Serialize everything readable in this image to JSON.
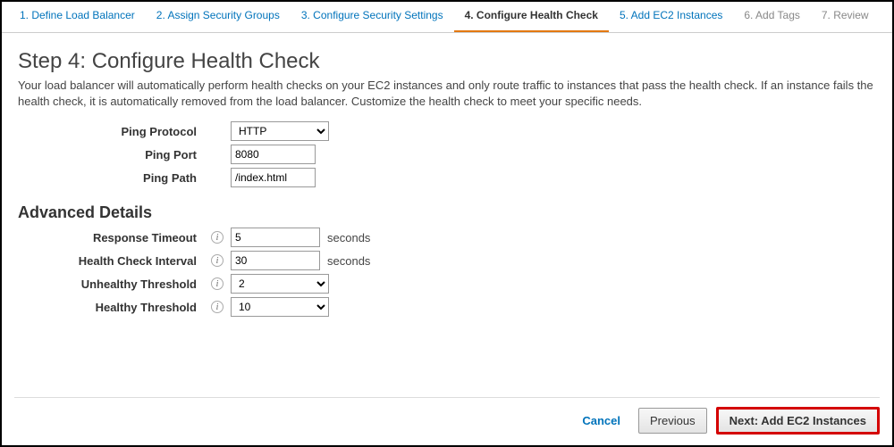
{
  "tabs": {
    "t1": "1. Define Load Balancer",
    "t2": "2. Assign Security Groups",
    "t3": "3. Configure Security Settings",
    "t4": "4. Configure Health Check",
    "t5": "5. Add EC2 Instances",
    "t6": "6. Add Tags",
    "t7": "7. Review"
  },
  "header": {
    "title": "Step 4: Configure Health Check",
    "intro": "Your load balancer will automatically perform health checks on your EC2 instances and only route traffic to instances that pass the health check. If an instance fails the health check, it is automatically removed from the load balancer. Customize the health check to meet your specific needs."
  },
  "form": {
    "ping_protocol": {
      "label": "Ping Protocol",
      "value": "HTTP"
    },
    "ping_port": {
      "label": "Ping Port",
      "value": "8080"
    },
    "ping_path": {
      "label": "Ping Path",
      "value": "/index.html"
    }
  },
  "advanced_title": "Advanced Details",
  "advanced": {
    "response_timeout": {
      "label": "Response Timeout",
      "value": "5",
      "unit": "seconds"
    },
    "interval": {
      "label": "Health Check Interval",
      "value": "30",
      "unit": "seconds"
    },
    "unhealthy_threshold": {
      "label": "Unhealthy Threshold",
      "value": "2"
    },
    "healthy_threshold": {
      "label": "Healthy Threshold",
      "value": "10"
    }
  },
  "footer": {
    "cancel": "Cancel",
    "previous": "Previous",
    "next": "Next: Add EC2 Instances"
  }
}
